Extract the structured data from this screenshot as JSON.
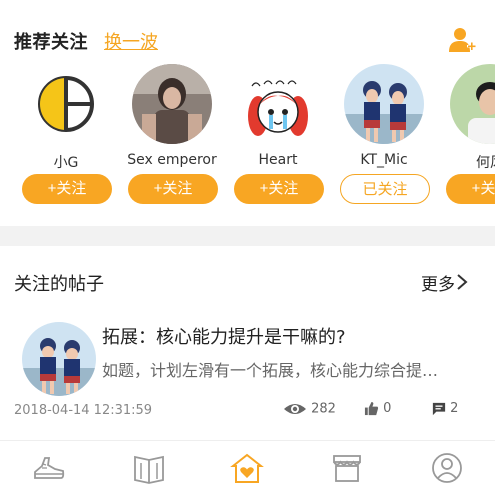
{
  "recommend": {
    "title": "推荐关注",
    "refresh_label": "换一波"
  },
  "users": [
    {
      "name": "小G",
      "follow_label": "+关注",
      "followed": false
    },
    {
      "name": "Sex emperor",
      "follow_label": "+关注",
      "followed": false
    },
    {
      "name": "Heart",
      "follow_label": "+关注",
      "followed": false
    },
    {
      "name": "KT_Mic",
      "follow_label": "已关注",
      "followed": true
    },
    {
      "name": "何风",
      "follow_label": "+关注",
      "followed": false
    }
  ],
  "posts_section": {
    "title": "关注的帖子",
    "more_label": "更多"
  },
  "post": {
    "title": "拓展：核心能力提升是干嘛的?",
    "summary": "如题，计划左滑有一个拓展，核心能力综合提…",
    "time": "2018-04-14 12:31:59",
    "views": "282",
    "likes": "0",
    "comments": "2"
  },
  "nav": {
    "items": [
      {
        "icon": "sneaker-icon"
      },
      {
        "icon": "book-icon"
      },
      {
        "icon": "home-heart-icon",
        "active": true
      },
      {
        "icon": "store-icon"
      },
      {
        "icon": "profile-icon"
      }
    ]
  },
  "colors": {
    "accent": "#f8a623",
    "divider": "#f2f2f2",
    "nav_inactive": "#999999"
  }
}
